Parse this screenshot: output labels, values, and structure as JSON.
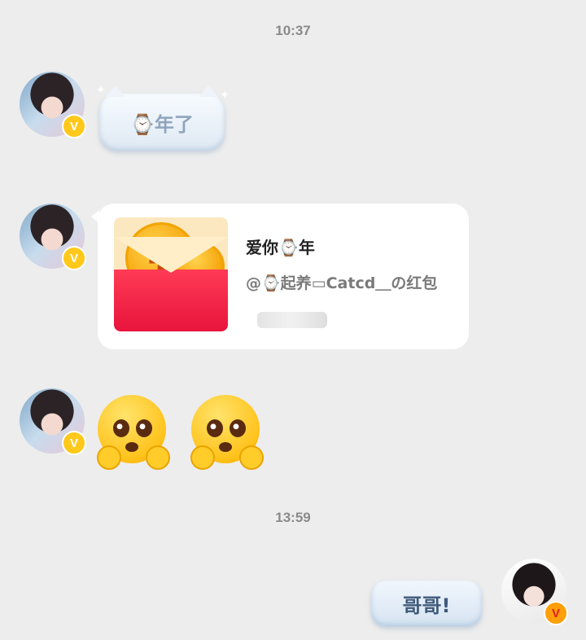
{
  "timestamps": [
    "10:37",
    "13:59"
  ],
  "messages": {
    "msg1": {
      "text": "⌚年了"
    },
    "redpacket": {
      "title": "爱你⌚年",
      "subtitle": "@⌚起养▭Catcd＿の红包"
    },
    "outgoing": {
      "text": "哥哥!"
    }
  },
  "badges": {
    "verified": "V"
  },
  "icons": [
    "avatar",
    "verified-badge-icon",
    "red-packet-icon",
    "pleading-face-emoji"
  ],
  "colors": {
    "background": "#ededed",
    "bubble": "#e6eef6",
    "redpacket": "#e8143d",
    "badge": "#ffc81a"
  }
}
